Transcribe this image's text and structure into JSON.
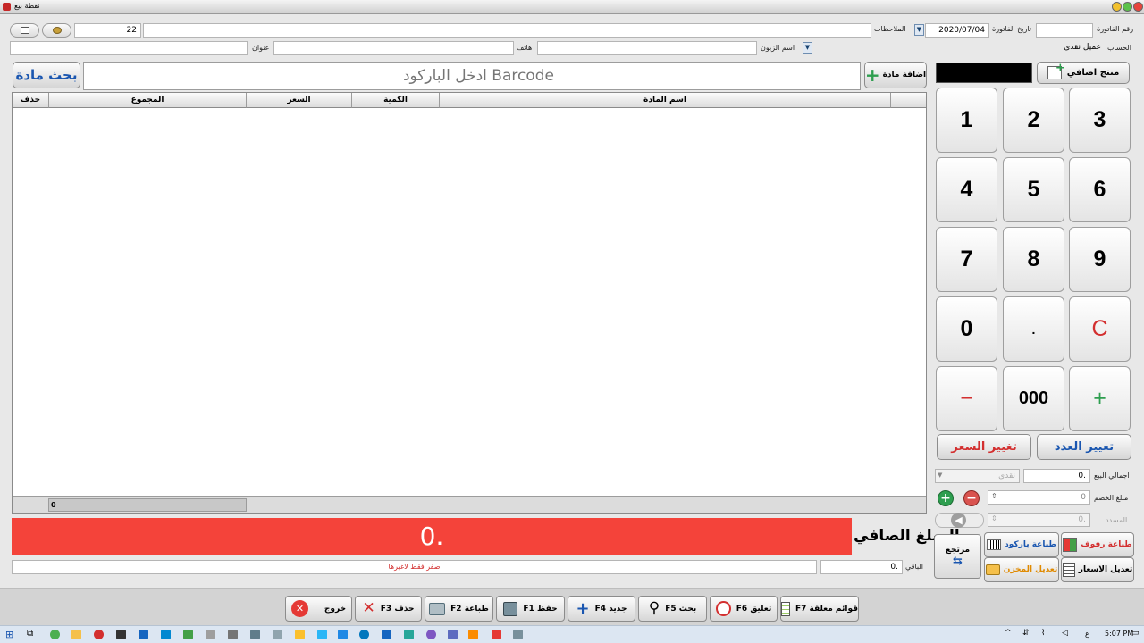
{
  "window": {
    "title": "نقطة بيع"
  },
  "header": {
    "invoice_number_label": "رقم الفاتورة",
    "invoice_number_value": "",
    "invoice_date_label": "تاريخ الفاتورة",
    "invoice_date_value": "2020/07/04",
    "notes_label": "الملاحظات",
    "notes_value": "",
    "counter_value": "22",
    "account_label": "الحساب",
    "account_value": "عميل نقدى",
    "customer_name_label": "اسم الزبون",
    "customer_name_value": "",
    "phone_label": "هاتف",
    "phone_value": "",
    "address_label": "عنوان",
    "address_value": ""
  },
  "search": {
    "search_product_label": "بحث مادة",
    "barcode_placeholder": "ادخل الباركود Barcode",
    "add_product_label": "اضافة مادة"
  },
  "table": {
    "columns": [
      "اسم المادة",
      "الكمية",
      "السعر",
      "المجموع",
      "حذف"
    ],
    "footer_total": "0"
  },
  "keypad": {
    "extra_product_label": "منتج اضافي",
    "keys": [
      "3",
      "2",
      "1",
      "6",
      "5",
      "4",
      "9",
      "8",
      "7",
      "C",
      ".",
      "0",
      "+",
      "000",
      "−"
    ],
    "change_qty_label": "تغيير العدد",
    "change_price_label": "تغيير السعر"
  },
  "totals": {
    "total_sale_label": "اجمالي البيع",
    "total_sale_value": "0.",
    "payment_type_value": "نقدى",
    "discount_label": "مبلغ الخصم",
    "discount_value": "0",
    "paid_label": "المسدد",
    "paid_value": "0.",
    "net_label": "المبلغ الصافي",
    "net_value": "0.",
    "remaining_label": "الباقي",
    "remaining_value": "0.",
    "amount_words": "صفر فقط لاغيرها"
  },
  "actions": {
    "print_shelves": "طباعة رفوف",
    "print_barcode": "طباعة باركود",
    "return_label": "مرتجع",
    "edit_prices": "تعديل الاسعار",
    "edit_store": "تعديل المخزن"
  },
  "toolbar": {
    "pending_lists": "قوائم معلقة F7",
    "suspend": "تعليق F6",
    "search": "بحث F5",
    "new": "جديد F4",
    "save": "حفظ F1",
    "print": "طباعة F2",
    "delete": "حذف F3",
    "exit": "خروج"
  },
  "taskbar": {
    "time": "5:07 PM",
    "lang": "ع"
  },
  "colors": {
    "net_bar": "#f4433a",
    "accent_blue": "#1a56b0",
    "accent_red": "#d32f2f",
    "accent_green": "#2e9e4f"
  }
}
